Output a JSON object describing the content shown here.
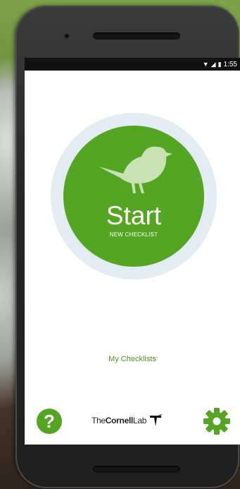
{
  "statusbar": {
    "time": "1:55"
  },
  "main": {
    "start_label": "Start",
    "start_sub": "NEW CHECKLIST",
    "my_checklists": "My Checklists"
  },
  "footer": {
    "help_glyph": "?",
    "logo_prefix": "The",
    "logo_name": "Cornell",
    "logo_suffix": "Lab"
  },
  "icons": [
    "bird-icon",
    "help-icon",
    "settings-icon",
    "wifi-icon",
    "signal-icon",
    "battery-icon",
    "cornell-lab-icon"
  ],
  "colors": {
    "accent": "#54a622",
    "halo": "#e4ecf3",
    "link": "#4a9a1f",
    "statusbar": "#111111"
  }
}
